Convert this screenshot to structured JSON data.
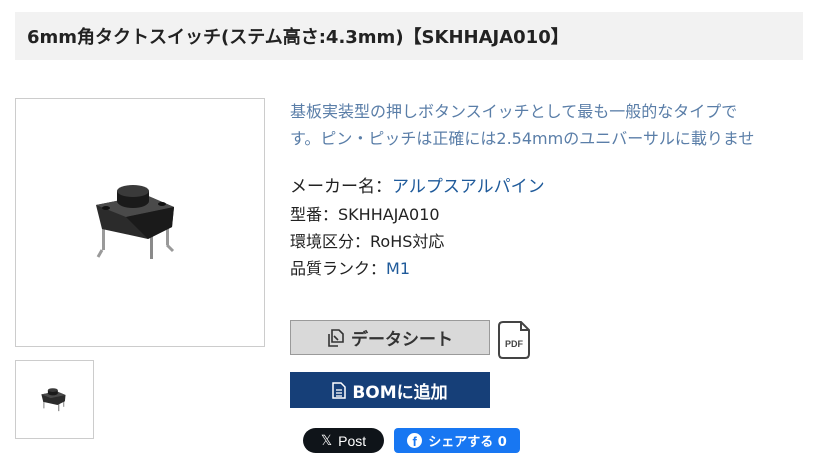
{
  "product": {
    "title": "6mm角タクトスイッチ(ステム高さ:4.3mm)【SKHHAJA010】",
    "description_lines": [
      "基板実装型の押しボタンスイッチとして最も一般的なタイプで",
      "す。ピン・ピッチは正確には2.54mmのユニバーサルに載りませ"
    ],
    "specs": {
      "maker_label": "メーカー名：",
      "maker_value": "アルプスアルパイン",
      "model_label": "型番：",
      "model_value": "SKHHAJA010",
      "env_label": "環境区分：",
      "env_value": "RoHS対応",
      "quality_label": "品質ランク：",
      "quality_value": "M1"
    }
  },
  "actions": {
    "datasheet_label": "データシート",
    "pdf_label": "PDF",
    "bom_label": "BOMに追加"
  },
  "social": {
    "x_label": "Post",
    "x_glyph": "𝕏",
    "fb_label": "シェアする 0",
    "fb_glyph": "f"
  },
  "colors": {
    "accent": "#163f78",
    "link": "#1f5a9a",
    "description": "#5a7ea8",
    "facebook": "#1877f2"
  },
  "icons": {
    "datasheet": "copy-document-icon",
    "pdf": "pdf-file-icon",
    "bom": "document-icon",
    "x": "x-logo-icon",
    "facebook": "facebook-icon"
  }
}
